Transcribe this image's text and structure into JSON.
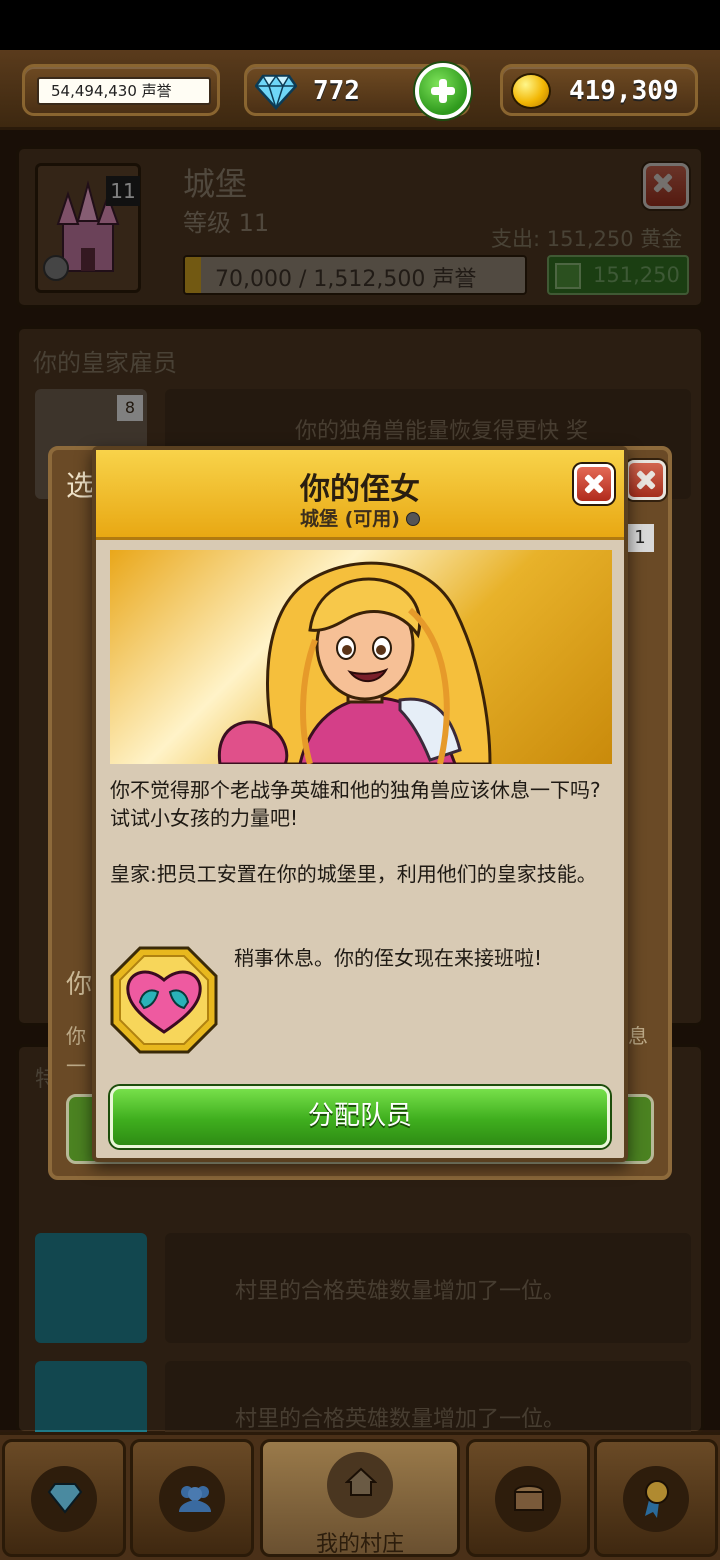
{
  "topbar": {
    "fame_label": "54,494,430 声誉",
    "gems": "772",
    "gold": "419,309"
  },
  "building": {
    "name": "城堡",
    "level_badge": "11",
    "level_label": "等级 11",
    "cost_label": "支出: 151,250 黄金",
    "progress_label": "70,000 / 1,512,500 声誉",
    "progress_fraction": 0.046,
    "upgrade_amount": "151,250"
  },
  "background": {
    "section_title": "你的皇家雇员",
    "row1_badge": "8",
    "row1_text": "你的独角兽能量恢复得更快 奖",
    "select_prefix": "选",
    "card_badge": "1",
    "you_prefix": "你",
    "you_prefix2": "你",
    "rest_suffix": "息",
    "dash": "一",
    "special_prefix": "特",
    "hero_text_1": "村里的合格英雄数量增加了一位。",
    "hero_text_2": "村里的合格英雄数量增加了一位。"
  },
  "popup": {
    "title": "你的侄女",
    "subtitle": "城堡 (可用)",
    "description": "你不觉得那个老战争英雄和他的独角兽应该休息一下吗?试试小女孩的力量吧!",
    "royal_note": "皇家:把员工安置在你的城堡里，利用他们的皇家技能。",
    "skill_text": "稍事休息。你的侄女现在来接班啦!",
    "assign_label": "分配队员"
  },
  "nav": {
    "village_label": "我的村庄"
  }
}
